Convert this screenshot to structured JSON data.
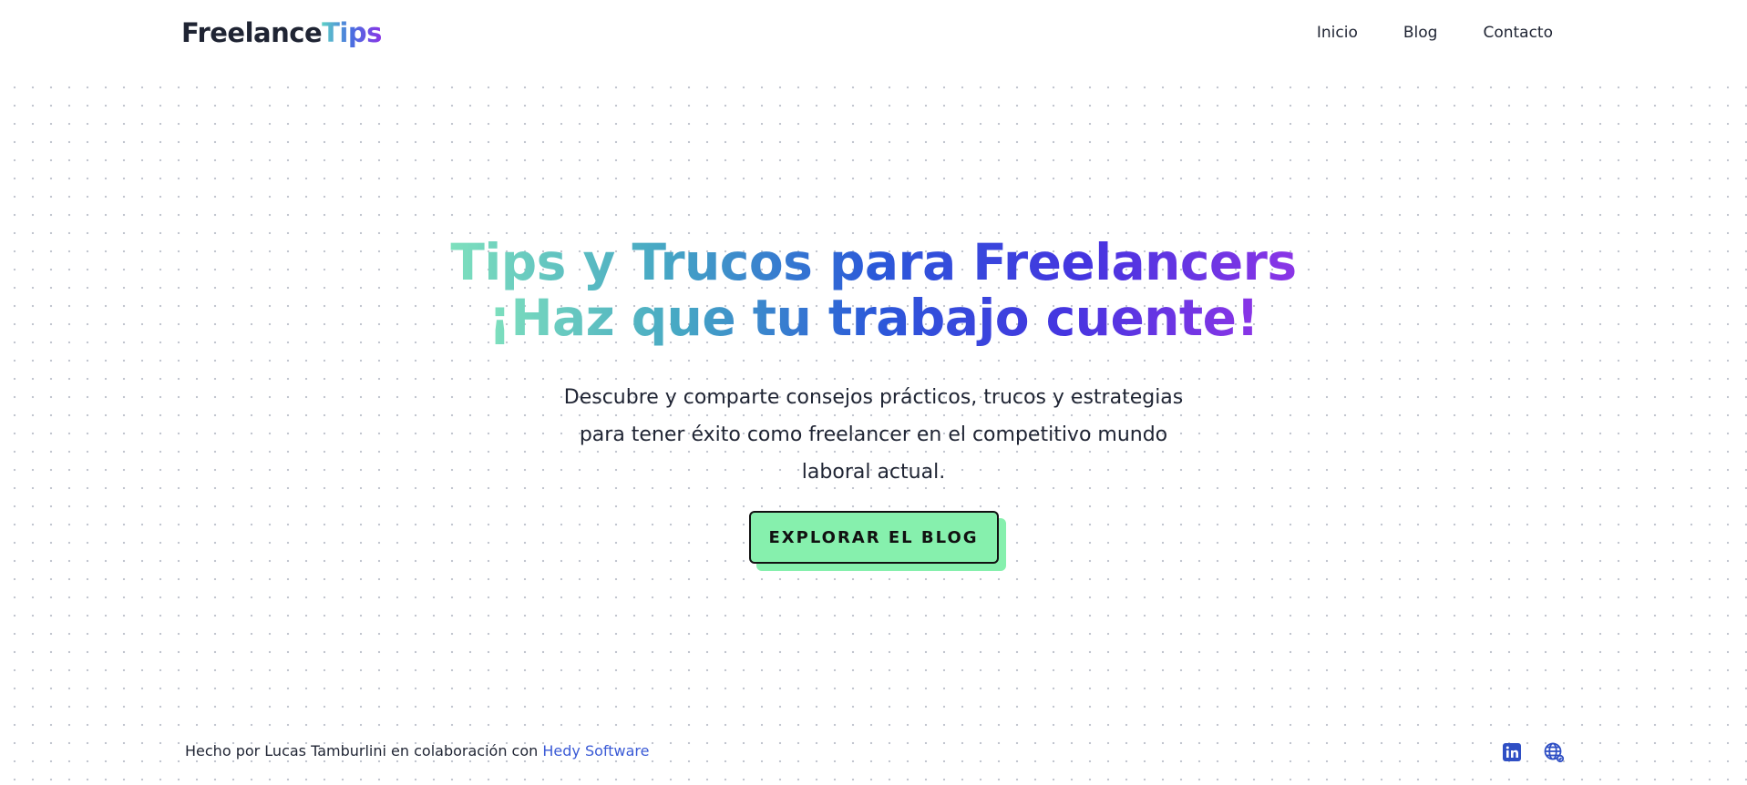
{
  "header": {
    "logo_part1": "Freelance",
    "logo_part2": "Tips",
    "nav": [
      "Inicio",
      "Blog",
      "Contacto"
    ]
  },
  "hero": {
    "headline_line1": "Tips y Trucos para Freelancers",
    "headline_line2": "¡Haz que tu trabajo cuente!",
    "subtitle": "Descubre y comparte consejos prácticos, trucos y estrategias para tener éxito como freelancer en el competitivo mundo laboral actual.",
    "cta_label": "EXPLORAR EL BLOG"
  },
  "footer": {
    "credit_text": "Hecho por Lucas Tamburlini en colaboración con ",
    "credit_link": "Hedy Software",
    "icons": [
      "linkedin-icon",
      "globe-icon"
    ]
  },
  "colors": {
    "accent_green": "#86f0ad",
    "link_blue": "#3b5bd6",
    "gradient_start": "#7ee0bd",
    "gradient_mid": "#2b59d9",
    "gradient_end": "#8b35e6"
  }
}
